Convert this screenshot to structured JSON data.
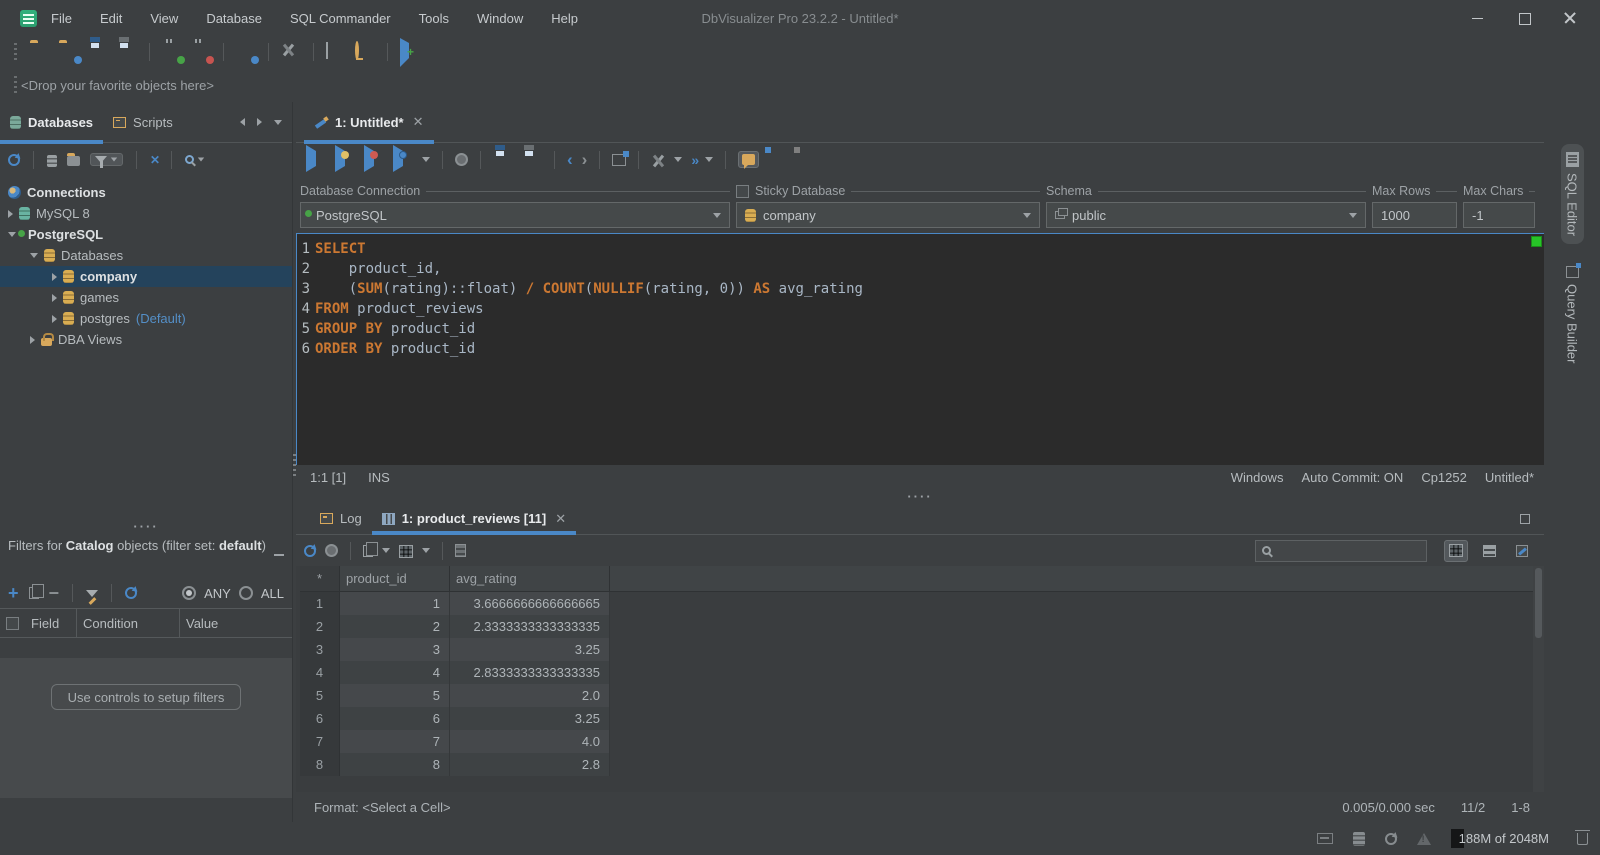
{
  "window": {
    "title": "DbVisualizer Pro 23.2.2 - Untitled*"
  },
  "menu": {
    "items": [
      "File",
      "Edit",
      "View",
      "Database",
      "SQL Commander",
      "Tools",
      "Window",
      "Help"
    ]
  },
  "favorites_bar": {
    "text": "<Drop your favorite objects here>"
  },
  "sidebar": {
    "tabs": [
      {
        "label": "Databases"
      },
      {
        "label": "Scripts"
      }
    ],
    "tree": {
      "root": "Connections",
      "items": [
        {
          "label": "MySQL 8"
        },
        {
          "label": "PostgreSQL"
        },
        {
          "label": "Databases"
        },
        {
          "label": "company",
          "selected": true
        },
        {
          "label": "games"
        },
        {
          "label": "postgres",
          "badge": "(Default)"
        },
        {
          "label": "DBA Views"
        }
      ]
    },
    "filters": {
      "title_prefix": "Filters for ",
      "title_bold1": "Catalog",
      "title_mid": " objects (filter set: ",
      "title_bold2": "default",
      "title_suffix": ")",
      "radio_any": "ANY",
      "radio_all": "ALL",
      "columns": [
        "Field",
        "Condition",
        "Value"
      ],
      "empty_button": "Use controls to setup filters"
    }
  },
  "editor": {
    "tab": "1: Untitled*",
    "fields": {
      "connection_label": "Database Connection",
      "connection_value": "PostgreSQL",
      "sticky_label": "Sticky Database",
      "database_value": "company",
      "schema_label": "Schema",
      "schema_value": "public",
      "max_rows_label": "Max Rows",
      "max_rows_value": "1000",
      "max_chars_label": "Max Chars",
      "max_chars_value": "-1"
    },
    "sql": [
      {
        "n": "1",
        "tokens": [
          {
            "s": "kw",
            "t": "SELECT"
          }
        ]
      },
      {
        "n": "2",
        "tokens": [
          {
            "s": "pl",
            "t": "    product_id,"
          }
        ]
      },
      {
        "n": "3",
        "tokens": [
          {
            "s": "pl",
            "t": "    ("
          },
          {
            "s": "kw",
            "t": "SUM"
          },
          {
            "s": "pl",
            "t": "(rating)::float) "
          },
          {
            "s": "kw",
            "t": "/"
          },
          {
            "s": "pl",
            "t": " "
          },
          {
            "s": "kw",
            "t": "COUNT"
          },
          {
            "s": "pl",
            "t": "("
          },
          {
            "s": "kw",
            "t": "NULLIF"
          },
          {
            "s": "pl",
            "t": "(rating, 0)) "
          },
          {
            "s": "kw",
            "t": "AS"
          },
          {
            "s": "pl",
            "t": " avg_rating"
          }
        ]
      },
      {
        "n": "4",
        "tokens": [
          {
            "s": "kw",
            "t": "FROM"
          },
          {
            "s": "pl",
            "t": " product_reviews"
          }
        ]
      },
      {
        "n": "5",
        "tokens": [
          {
            "s": "kw",
            "t": "GROUP BY"
          },
          {
            "s": "pl",
            "t": " product_id"
          }
        ]
      },
      {
        "n": "6",
        "tokens": [
          {
            "s": "kw",
            "t": "ORDER BY"
          },
          {
            "s": "pl",
            "t": " product_id"
          }
        ]
      }
    ],
    "status": {
      "caret": "1:1 [1]",
      "mode": "INS",
      "platform": "Windows",
      "auto_commit": "Auto Commit: ON",
      "encoding": "Cp1252",
      "doc": "Untitled*"
    }
  },
  "results": {
    "tabs": {
      "log": "Log",
      "grid": "1: product_reviews [11]"
    },
    "columns": [
      "*",
      "product_id",
      "avg_rating"
    ],
    "rows": [
      [
        "1",
        "1",
        "3.6666666666666665"
      ],
      [
        "2",
        "2",
        "2.3333333333333335"
      ],
      [
        "3",
        "3",
        "3.25"
      ],
      [
        "4",
        "4",
        "2.8333333333333335"
      ],
      [
        "5",
        "5",
        "2.0"
      ],
      [
        "6",
        "6",
        "3.25"
      ],
      [
        "7",
        "7",
        "4.0"
      ],
      [
        "8",
        "8",
        "2.8"
      ]
    ],
    "footer": {
      "format": "Format: <Select a Cell>",
      "timing": "0.005/0.000 sec",
      "counts": "11/2",
      "range": "1-8"
    }
  },
  "right_tabs": [
    {
      "label": "SQL Editor"
    },
    {
      "label": "Query Builder"
    }
  ],
  "statusbar": {
    "memory": "188M of 2048M"
  },
  "colors": {
    "accent": "#4a88c7",
    "keyword": "#cc7832",
    "selection": "#24435c",
    "marker_ok": "#27c427"
  }
}
